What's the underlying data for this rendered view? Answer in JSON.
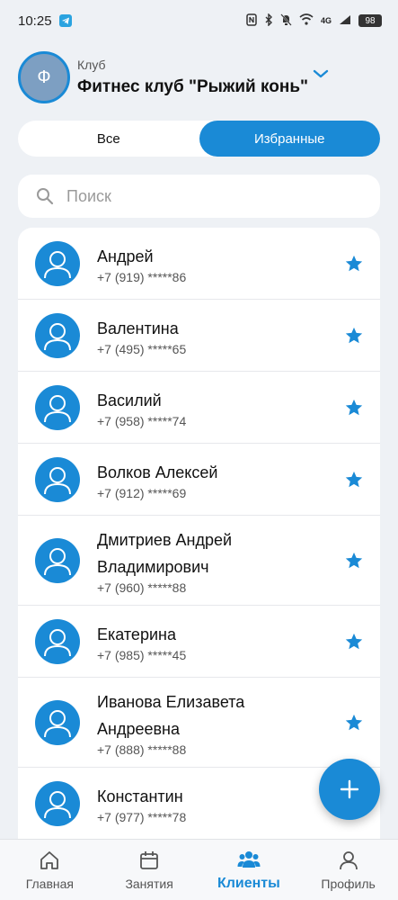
{
  "status_bar": {
    "time": "10:25",
    "battery": "98",
    "network": "4G"
  },
  "club": {
    "avatar_letter": "Ф",
    "label": "Клуб",
    "name": "Фитнес клуб \"Рыжий конь\""
  },
  "segments": {
    "all": "Все",
    "favorites": "Избранные"
  },
  "search": {
    "placeholder": "Поиск"
  },
  "clients": [
    {
      "name": "Андрей",
      "phone": "+7 (919) *****86"
    },
    {
      "name": "Валентина",
      "phone": "+7 (495) *****65"
    },
    {
      "name": "Василий",
      "phone": "+7 (958) *****74"
    },
    {
      "name": "Волков Алексей",
      "phone": "+7 (912) *****69"
    },
    {
      "name_line1": "Дмитриев Андрей",
      "name_line2": "Владимирович",
      "phone": "+7 (960) *****88"
    },
    {
      "name": "Екатерина",
      "phone": "+7 (985) *****45"
    },
    {
      "name_line1": "Иванова Елизавета",
      "name_line2": "Андреевна",
      "phone": "+7 (888) *****88"
    },
    {
      "name": "Константин",
      "phone": "+7 (977) *****78"
    }
  ],
  "nav": {
    "home": "Главная",
    "classes": "Занятия",
    "clients": "Клиенты",
    "profile": "Профиль"
  },
  "colors": {
    "accent": "#1a8ad6",
    "background": "#eef1f5"
  }
}
